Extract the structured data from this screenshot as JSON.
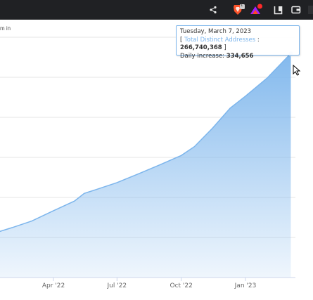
{
  "browser": {
    "icons": [
      "share-icon",
      "brave-shield-icon",
      "brave-rewards-icon",
      "sidebar-icon",
      "wallet-icon"
    ],
    "shield_badge": "1"
  },
  "chart": {
    "zoom_label": "m in",
    "tooltip": {
      "date": "Tuesday, March 7, 2023",
      "bracket_open": "[",
      "series_name": "Total Distinct Addresses",
      "separator": ":",
      "series_value": "266,740,368",
      "bracket_close": "]",
      "increase_label": "Daily Increase:",
      "increase_value": "334,656"
    }
  },
  "chart_data": {
    "type": "area",
    "x_tick_labels": [
      "Apr '22",
      "Jul '22",
      "Oct '22",
      "Jan '23"
    ],
    "series": [
      {
        "values": [
          [
            "2022-01-01",
            0.18
          ],
          [
            "2022-02-01",
            0.208
          ],
          [
            "2022-03-01",
            0.235
          ],
          [
            "2022-04-01",
            0.278
          ],
          [
            "2022-05-01",
            0.318
          ],
          [
            "2022-05-15",
            0.35
          ],
          [
            "2022-06-01",
            0.366
          ],
          [
            "2022-07-01",
            0.395
          ],
          [
            "2022-08-01",
            0.432
          ],
          [
            "2022-09-01",
            0.47
          ],
          [
            "2022-10-01",
            0.508
          ],
          [
            "2022-10-20",
            0.545
          ],
          [
            "2022-11-15",
            0.622
          ],
          [
            "2022-12-10",
            0.705
          ],
          [
            "2023-01-01",
            0.755
          ],
          [
            "2023-02-01",
            0.83
          ],
          [
            "2023-03-01",
            0.915
          ],
          [
            "2023-03-07",
            0.932
          ]
        ]
      }
    ],
    "fill_color": "#7cb5ec",
    "grid": true,
    "colors": {
      "accent": "#7cb5ec",
      "toolbar": "#202124"
    }
  }
}
